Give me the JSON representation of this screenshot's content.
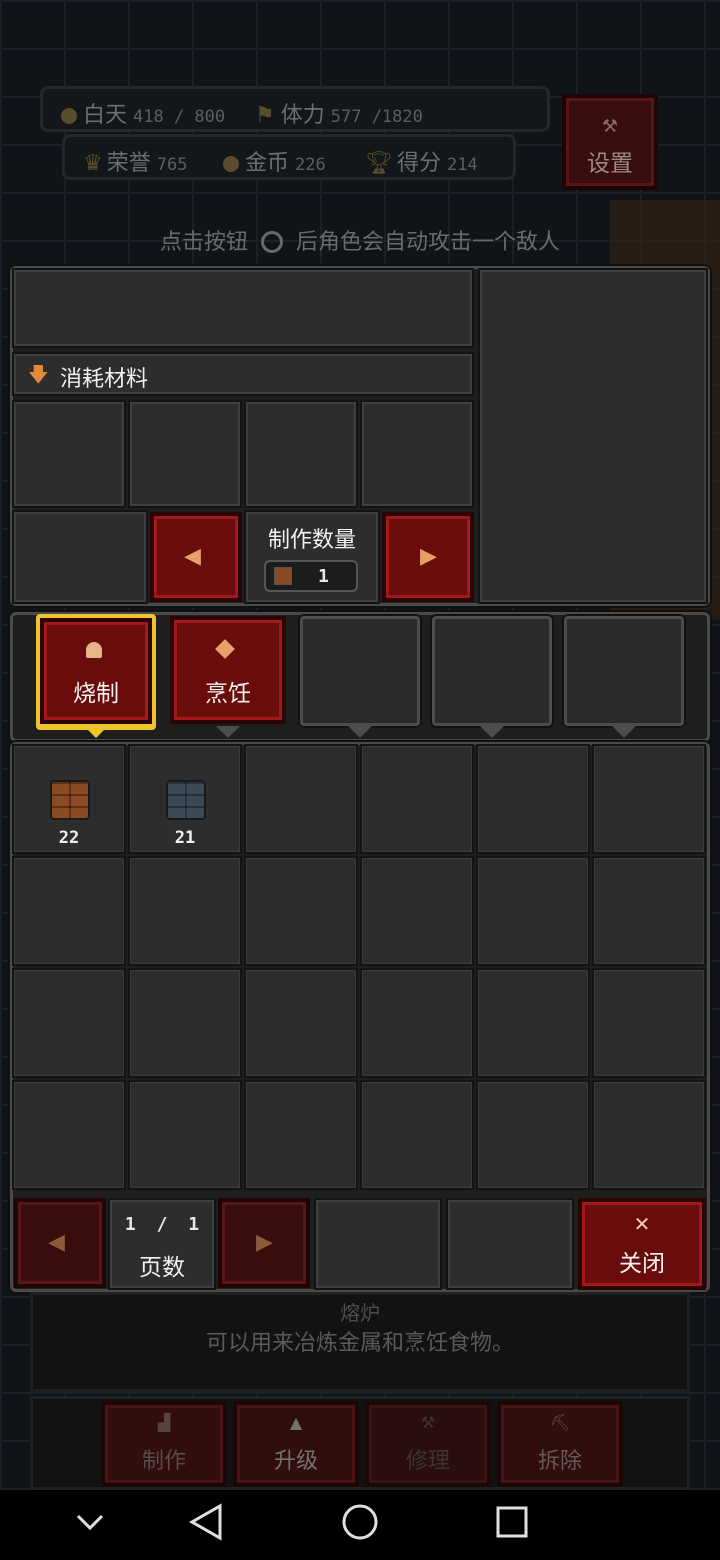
{
  "hud": {
    "day_label": "白天",
    "day_value": "418 / 800",
    "stamina_label": "体力",
    "stamina_value": "577 /1820",
    "honor_label": "荣誉",
    "honor_value": "765",
    "gold_label": "金币",
    "gold_value": "226",
    "score_label": "得分",
    "score_value": "214",
    "settings_label": "设置"
  },
  "hint": {
    "before": "点击按钮",
    "after": "后角色会自动攻击一个敌人"
  },
  "craft": {
    "materials_label": "消耗材料",
    "quantity_title": "制作数量",
    "quantity_value": "1"
  },
  "tabs": [
    {
      "label": "烧制",
      "icon": "bell-icon",
      "selected": true
    },
    {
      "label": "烹饪",
      "icon": "diamond-icon",
      "selected": false
    }
  ],
  "inventory": {
    "items": [
      {
        "name": "copper-ingot",
        "count": "22",
        "color": "#8a4a24"
      },
      {
        "name": "iron-ingot",
        "count": "21",
        "color": "#3c4a57"
      }
    ]
  },
  "pager": {
    "current": "1",
    "separator": "/",
    "total": "1",
    "label": "页数"
  },
  "close_label": "关闭",
  "building": {
    "name": "熔炉",
    "description": "可以用来冶炼金属和烹饪食物。",
    "actions": [
      "制作",
      "升级",
      "修理",
      "拆除"
    ]
  },
  "colors": {
    "accent_red": "#6a0c0c",
    "highlight_gold": "#f0c52c",
    "panel": "#2b2b2b"
  }
}
